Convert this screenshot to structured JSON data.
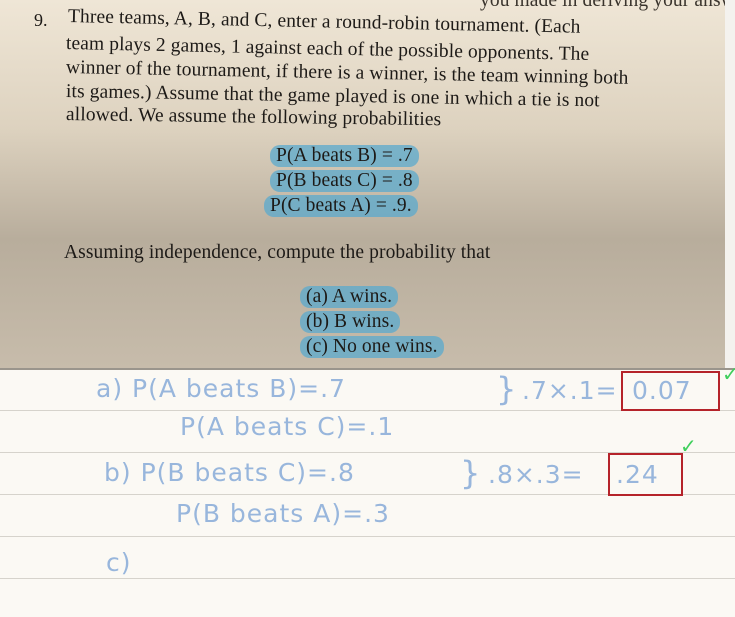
{
  "book": {
    "cutoff_line": "you made in deriving your answer?",
    "problem_number": "9.",
    "lines": [
      "Three teams, A, B, and C, enter a round-robin tournament. (Each",
      "team plays 2 games, 1 against each of the possible opponents. The",
      "winner of the tournament, if there is a winner, is the team winning both",
      "its games.) Assume that the game played is one in which a tie is not",
      "allowed. We assume the following probabilities"
    ],
    "probabilities": [
      "P(A beats B) = .7",
      "P(B beats C) = .8",
      "P(C beats A) = .9."
    ],
    "instruction": "Assuming independence, compute the probability that",
    "parts": [
      "(a) A wins.",
      "(b) B wins.",
      "(c) No one wins."
    ]
  },
  "notes": {
    "a_line1": "a)  P(A beats B)=.7",
    "a_line2": "P(A beats C)=.1",
    "a_calc": ".7×.1=",
    "a_answer": "0.07",
    "b_line1": "b) P(B beats C)=.8",
    "b_line2": "P(B beats A)=.3",
    "b_calc": ".8×.3=",
    "b_answer": ".24",
    "c_line": "c)",
    "check_mark": "✓",
    "ink_color": "#98b6dc",
    "box_color": "#b5232a",
    "check_color": "#3fcf5c"
  }
}
